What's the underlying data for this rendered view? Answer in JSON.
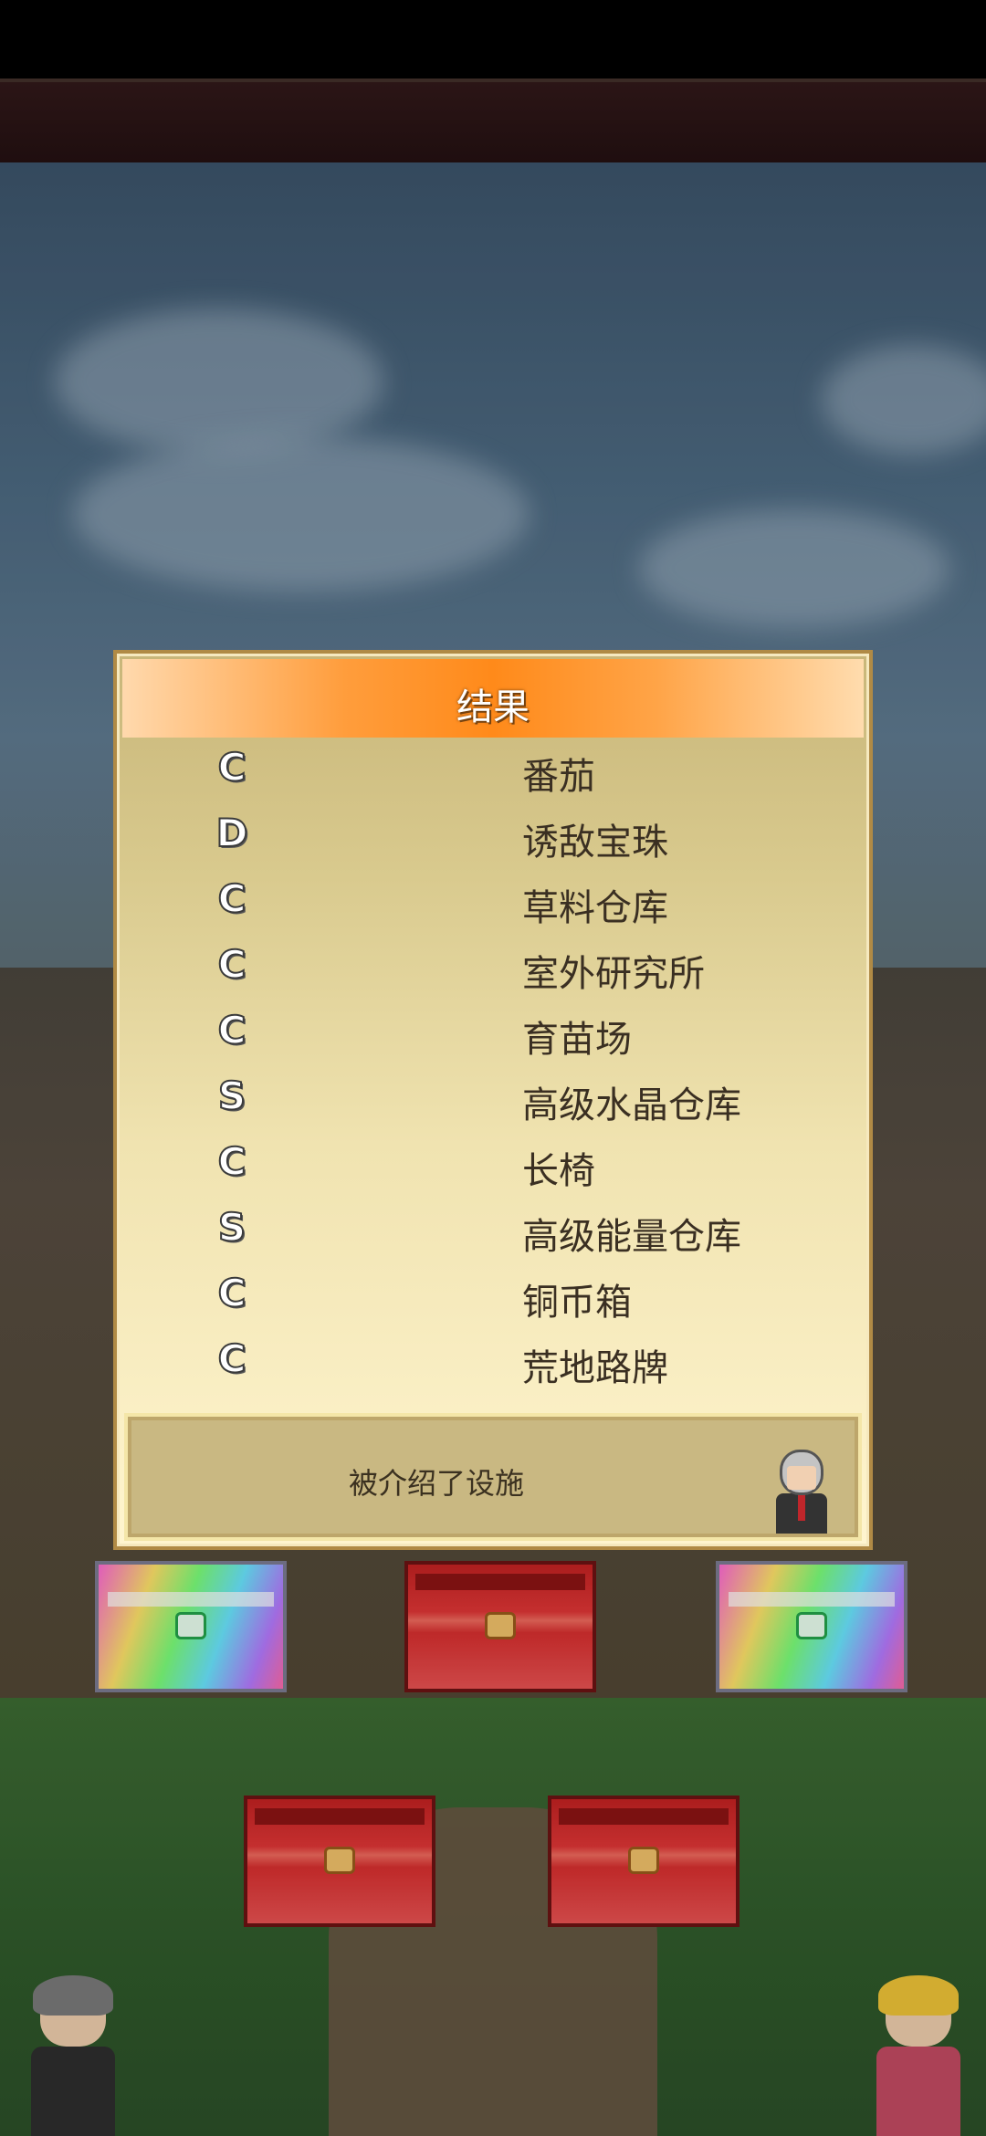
{
  "dialog": {
    "title": "结果",
    "results": [
      {
        "grade": "C",
        "name": "番茄"
      },
      {
        "grade": "D",
        "name": "诱敌宝珠"
      },
      {
        "grade": "C",
        "name": "草料仓库"
      },
      {
        "grade": "C",
        "name": "室外研究所"
      },
      {
        "grade": "C",
        "name": "育苗场"
      },
      {
        "grade": "S",
        "name": "高级水晶仓库"
      },
      {
        "grade": "C",
        "name": "长椅"
      },
      {
        "grade": "S",
        "name": "高级能量仓库"
      },
      {
        "grade": "C",
        "name": "铜币箱"
      },
      {
        "grade": "C",
        "name": "荒地路牌"
      }
    ],
    "message": "被介绍了设施",
    "message_avatar_icon": "gray-haired-advisor-icon"
  },
  "chests": [
    {
      "type": "rainbow",
      "icon": "rainbow-chest-icon"
    },
    {
      "type": "red",
      "icon": "red-chest-icon"
    },
    {
      "type": "rainbow",
      "icon": "rainbow-chest-icon"
    },
    {
      "type": "red",
      "icon": "red-chest-icon"
    },
    {
      "type": "red",
      "icon": "red-chest-icon"
    }
  ],
  "colors": {
    "header_orange": "#ff8a1a",
    "panel_cream": "#fff5cf",
    "chest_red": "#e03636"
  }
}
